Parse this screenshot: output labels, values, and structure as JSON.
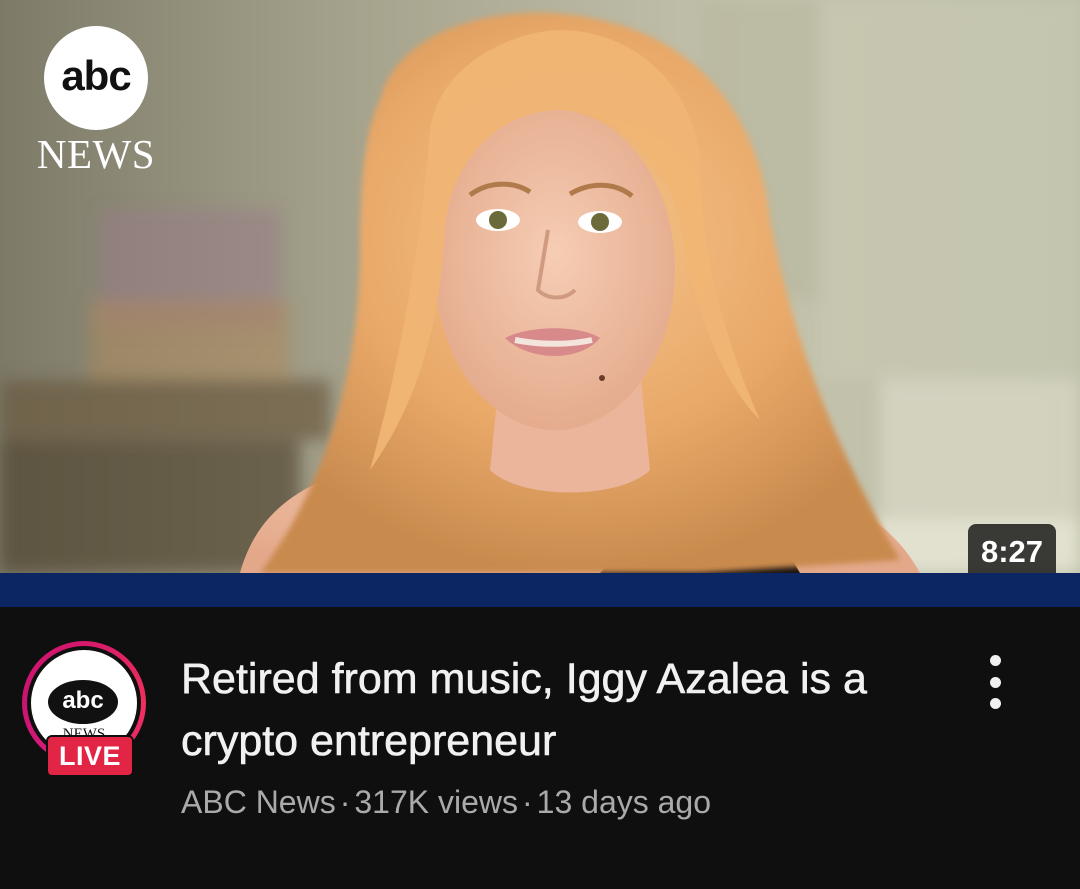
{
  "video": {
    "thumbnail_brand": {
      "logo_text": "abc",
      "logo_subtext": "NEWS"
    },
    "duration": "8:27",
    "watched_progress": 1.0,
    "title": "Retired from music, Iggy Azalea is a crypto entrepreneur",
    "channel": {
      "name": "ABC News",
      "avatar_logo_text": "abc",
      "avatar_logo_subtext": "NEWS",
      "live_label": "LIVE"
    },
    "views": "317K views",
    "age": "13 days ago",
    "separator": "·",
    "more_icon": "vertical-ellipsis-icon"
  },
  "colors": {
    "background": "#0f0f0f",
    "progress_bar": "#0b2663",
    "live_badge": "#e32545",
    "title_text": "#f1f1f1",
    "meta_text": "#aaaaaa"
  }
}
